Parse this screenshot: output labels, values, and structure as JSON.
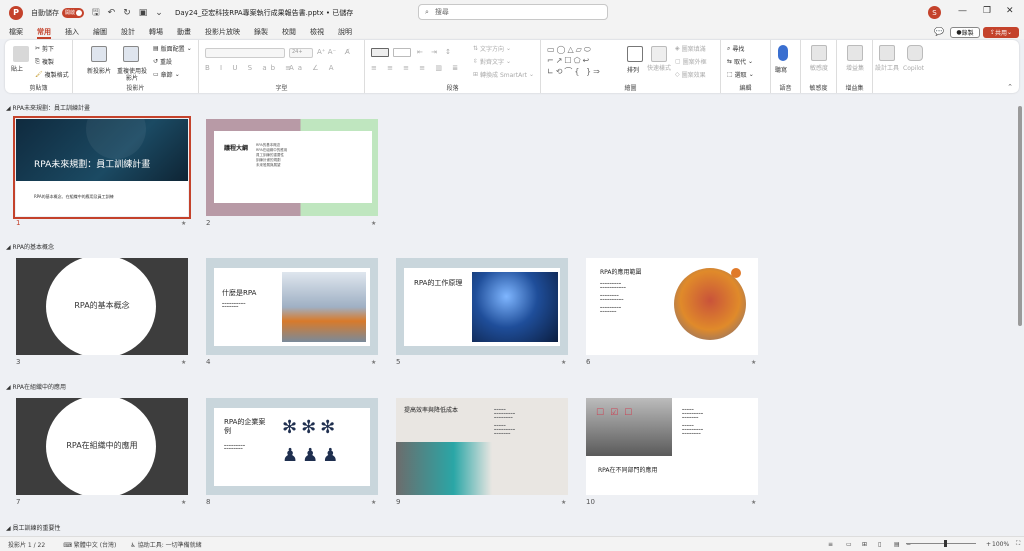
{
  "titlebar": {
    "autosave_label": "自動儲存",
    "autosave_state": "開啟",
    "doc_title": "Day24_亞宏科技RPA專案執行成果報告書.pptx • 已儲存",
    "search_placeholder": "搜尋",
    "user_initial": "S"
  },
  "tabs": [
    "檔案",
    "常用",
    "插入",
    "繪圖",
    "設計",
    "轉場",
    "動畫",
    "投影片放映",
    "錄製",
    "校閱",
    "檢視",
    "說明"
  ],
  "active_tab": "常用",
  "buttons": {
    "record": "錄製",
    "share": "共用"
  },
  "ribbon": {
    "clipboard": {
      "label": "剪貼簿",
      "paste": "貼上",
      "cut": "剪下",
      "copy": "複製",
      "format_painter": "複製格式"
    },
    "slides": {
      "label": "投影片",
      "new_slide": "新投影片",
      "reuse_slides": "重複使用投影片",
      "layout": "版面配置",
      "reset": "重設",
      "section": "章節"
    },
    "font": {
      "label": "字型",
      "size": "24+"
    },
    "paragraph": {
      "label": "段落",
      "text_direction": "文字方向",
      "align_text": "對齊文字",
      "smartart": "轉換成 SmartArt"
    },
    "drawing": {
      "label": "繪圖",
      "arrange": "排列",
      "quick_styles": "快速樣式",
      "shape_fill": "圖案填滿",
      "shape_outline": "圖案外框",
      "shape_effects": "圖案效果"
    },
    "editing": {
      "label": "編輯",
      "find": "尋找",
      "replace": "取代",
      "select": "選取"
    },
    "voice": {
      "label": "語音",
      "dictate": "聽寫"
    },
    "sensitivity": {
      "label": "敏感度",
      "name": "敏感度"
    },
    "addins": {
      "label": "增益集",
      "name": "增益集"
    },
    "designer": {
      "name": "設計工具"
    },
    "copilot": {
      "name": "Copilot"
    }
  },
  "sections": [
    {
      "title": "RPA未來規劃：員工訓練計畫"
    },
    {
      "title": "RPA的基本概念"
    },
    {
      "title": "RPA在組織中的應用"
    },
    {
      "title": "員工訓練的重要性"
    }
  ],
  "slides": [
    {
      "num": "1",
      "title": "RPA未來規劃：員工訓練計畫",
      "subtitle": "RPA的基本概念、在組織中的應用及員工訓練"
    },
    {
      "num": "2",
      "title": "議程大綱",
      "bullets": [
        "RPA的基本概念",
        "RPA在組織中的應用",
        "員工訓練的重要性",
        "訓練計畫的規劃",
        "未來發展與展望"
      ]
    },
    {
      "num": "3",
      "title": "RPA的基本概念"
    },
    {
      "num": "4",
      "title": "什麼是RPA"
    },
    {
      "num": "5",
      "title": "RPA的工作原理"
    },
    {
      "num": "6",
      "title": "RPA的應用範圍"
    },
    {
      "num": "7",
      "title": "RPA在組織中的應用"
    },
    {
      "num": "8",
      "title": "RPA的企業案例"
    },
    {
      "num": "9",
      "title": "提高效率與降低成本"
    },
    {
      "num": "10",
      "title": "RPA在不同部門的應用"
    }
  ],
  "status": {
    "slide_count": "投影片 1 / 22",
    "language": "繁體中文 (台灣)",
    "accessibility": "協助工具: 一切準備就緒",
    "zoom": "100%"
  },
  "colors": {
    "accent": "#c4422b",
    "ribbon_bg": "#ffffff",
    "app_bg": "#eef0f4"
  }
}
